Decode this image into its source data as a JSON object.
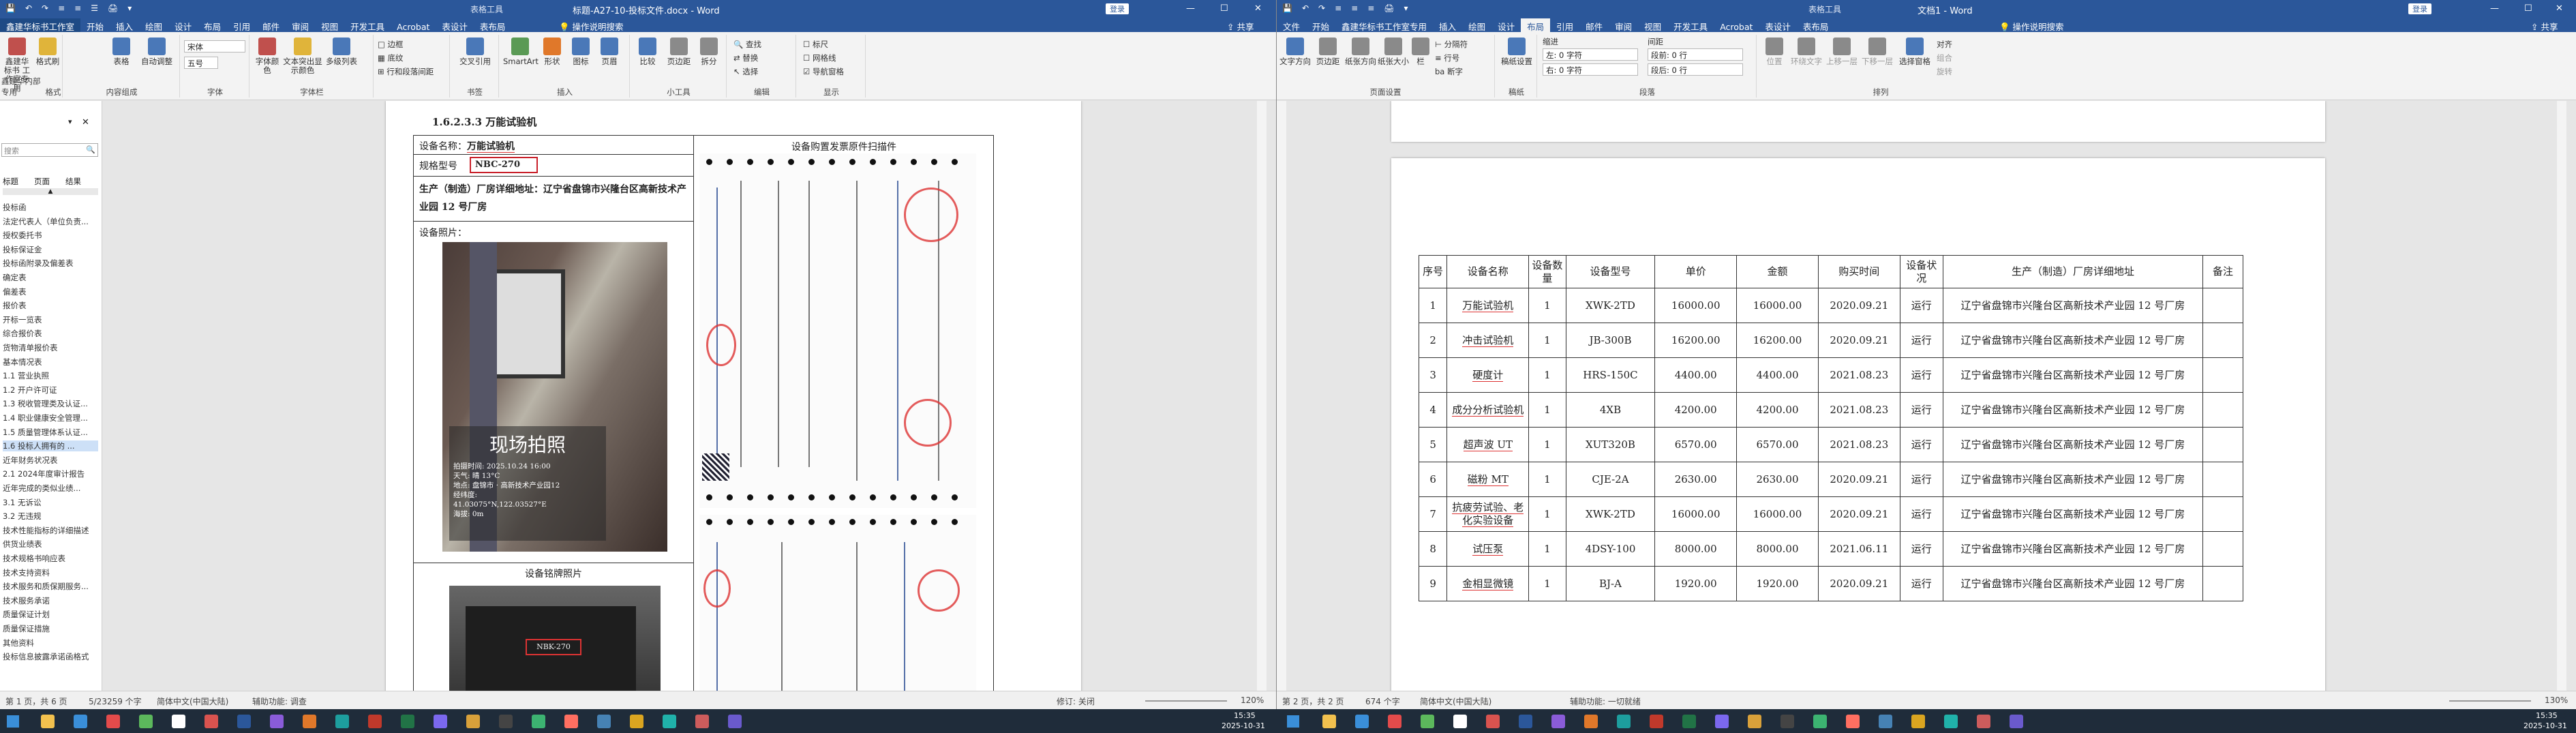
{
  "left_window": {
    "qa": [
      "💾",
      "↶",
      "↷",
      "≡",
      "≡",
      "☰",
      "🖨",
      "▾"
    ],
    "context_label": "表格工具",
    "title": "标题-A27-10-投标文件.docx  -  Word",
    "share": "共享",
    "login": "登录",
    "tabs": [
      "鑫建华标书工作室",
      "开始",
      "插入",
      "绘图",
      "设计",
      "布局",
      "引用",
      "邮件",
      "审阅",
      "视图",
      "开发工具",
      "Acrobat",
      "表设计",
      "表布局"
    ],
    "tell_me": "操作说明搜索",
    "ribbon": {
      "g1_btn": "鑫建华标书 工作室专用",
      "g1_btn2": "格式刷",
      "g1_label": "鑫建华内部专用",
      "g1b_label": "格式",
      "g2": [
        "表格",
        "自动调整"
      ],
      "g2_label": "内容组成",
      "font_name": "宋体",
      "font_size": "五号",
      "font_label": "字体",
      "g4": [
        "字体颜色",
        "文本突出显示颜色",
        "多级列表"
      ],
      "g4_label": "字体栏",
      "g5": [
        "□ 边框",
        "▦ 底纹",
        "⊞ 行和段落间距"
      ],
      "g6": [
        "交叉引用"
      ],
      "g6_label": "书签",
      "g7": [
        "SmartArt",
        "形状",
        "图标",
        "页眉"
      ],
      "g7_label": "插入",
      "g8": [
        "比较",
        "页边距",
        "拆分"
      ],
      "g8_label": "小工具",
      "g9": [
        "查找",
        "替换",
        "选择"
      ],
      "g9_label": "编辑",
      "g10": [
        "☐ 标尺",
        "☐ 网格线",
        "☑ 导航窗格"
      ],
      "g10_label": "显示"
    },
    "nav": {
      "search_placeholder": "搜索",
      "tabs": [
        "标题",
        "页面",
        "结果"
      ],
      "items": [
        "投标函",
        "法定代表人（单位负责...",
        "授权委托书",
        "投标保证金",
        "投标函附录及偏差表",
        "确定表",
        "偏差表",
        "报价表",
        "开标一览表",
        "综合报价表",
        "货物清单报价表",
        "基本情况表",
        "1.1 营业执照",
        "1.2 开户许可证",
        "1.3 税收管理类及认证...",
        "1.4 职业健康安全管理...",
        "1.5 质量管理体系认证...",
        "1.6 投标人拥有的 ...",
        "近年财务状况表",
        "2.1 2024年度审计报告",
        "近年完成的类似业绩...",
        "3.1 无诉讼",
        "3.2 无违规",
        "技术性能指标的详细描述",
        "供货业绩表",
        "技术规格书响应表",
        "技术支持资料",
        "技术服务和质保期服务...",
        "技术服务承诺",
        "质量保证计划",
        "质量保证措施",
        "其他资料",
        "投标信息披露承诺函格式"
      ],
      "selected": 17
    },
    "heading": "1.6.2.3.3  万能试验机",
    "form": {
      "name_label": "设备名称：",
      "name_val": "万能试验机",
      "model_label": "规格型号",
      "model_val": "NBC-270",
      "addr_label": "生产（制造）厂房详细地址：辽宁省盘锦市兴隆台区高新技术产业园 12 号厂房",
      "photo_label": "设备照片：",
      "nameplate_label": "设备铭牌照片",
      "invoice_label": "设备购置发票原件扫描件",
      "photo_overlay": "现场拍照",
      "photo_meta": [
        "拍摄时间: 2025.10.24 16:00",
        "天气: 晴 13°C",
        "地点: 盘锦市 · 高新技术产业园12",
        "经纬度:",
        "41.03075°N,122.03527°E",
        "海拔: 0m"
      ],
      "nameplate_model": "NBK-270"
    },
    "status": [
      "第 1 页，共 6 页",
      "5/23259 个字",
      "简体中文(中国大陆)",
      "辅助功能: 调查",
      "修订: 关闭"
    ],
    "zoom": "120%"
  },
  "right_window": {
    "qa": [
      "💾",
      "↶",
      "↷",
      "≡",
      "≡",
      "≡",
      "🖨",
      "▾"
    ],
    "context_label": "表格工具",
    "title": "文档1  -  Word",
    "login": "登录",
    "share": "共享",
    "tabs": [
      "文件",
      "开始",
      "鑫建华标书工作室专用",
      "插入",
      "绘图",
      "设计",
      "布局",
      "引用",
      "邮件",
      "审阅",
      "视图",
      "开发工具",
      "Acrobat",
      "表设计",
      "表布局"
    ],
    "tell_me": "操作说明搜索",
    "ribbon": {
      "g1": [
        "文字方向",
        "页边距",
        "纸张方向",
        "纸张大小",
        "栏"
      ],
      "g1_label": "页面设置",
      "g1_small": [
        "⊢ 分隔符",
        "≡ 行号",
        "ba 断字"
      ],
      "g2": [
        "稿纸设置"
      ],
      "g2_label": "稿纸",
      "indent_title": "缩进",
      "spacing_title": "间距",
      "indent": [
        "左: 0 字符",
        "右: 0 字符"
      ],
      "spacing": [
        "段前: 0 行",
        "段后: 0 行"
      ],
      "para_label": "段落",
      "g4": [
        "位置",
        "环绕文字",
        "上移一层",
        "下移一层",
        "选择窗格"
      ],
      "g4_small": [
        "对齐",
        "组合",
        "旋转"
      ],
      "g4_label": "排列"
    },
    "status": [
      "第 2 页，共 2 页",
      "674 个字",
      "简体中文(中国大陆)",
      "辅助功能: 一切就绪"
    ],
    "zoom": "130%",
    "table": {
      "headers": [
        "序号",
        "设备名称",
        "设备数量",
        "设备型号",
        "单价",
        "金额",
        "购买时间",
        "设备状况",
        "生产（制造）厂房详细地址",
        "备注"
      ],
      "rows": [
        [
          "1",
          "万能试验机",
          "1",
          "XWK-2TD",
          "16000.00",
          "16000.00",
          "2020.09.21",
          "运行",
          "辽宁省盘锦市兴隆台区高新技术产业园 12 号厂房",
          ""
        ],
        [
          "2",
          "冲击试验机",
          "1",
          "JB-300B",
          "16200.00",
          "16200.00",
          "2020.09.21",
          "运行",
          "辽宁省盘锦市兴隆台区高新技术产业园 12 号厂房",
          ""
        ],
        [
          "3",
          "硬度计",
          "1",
          "HRS-150C",
          "4400.00",
          "4400.00",
          "2021.08.23",
          "运行",
          "辽宁省盘锦市兴隆台区高新技术产业园 12 号厂房",
          ""
        ],
        [
          "4",
          "成分分析试验机",
          "1",
          "4XB",
          "4200.00",
          "4200.00",
          "2021.08.23",
          "运行",
          "辽宁省盘锦市兴隆台区高新技术产业园 12 号厂房",
          ""
        ],
        [
          "5",
          "超声波 UT",
          "1",
          "XUT320B",
          "6570.00",
          "6570.00",
          "2021.08.23",
          "运行",
          "辽宁省盘锦市兴隆台区高新技术产业园 12 号厂房",
          ""
        ],
        [
          "6",
          "磁粉 MT",
          "1",
          "CJE-2A",
          "2630.00",
          "2630.00",
          "2020.09.21",
          "运行",
          "辽宁省盘锦市兴隆台区高新技术产业园 12 号厂房",
          ""
        ],
        [
          "7",
          "抗疲劳试验、老化实验设备",
          "1",
          "XWK-2TD",
          "16000.00",
          "16000.00",
          "2020.09.21",
          "运行",
          "辽宁省盘锦市兴隆台区高新技术产业园 12 号厂房",
          ""
        ],
        [
          "8",
          "试压泵",
          "1",
          "4DSY-100",
          "8000.00",
          "8000.00",
          "2021.06.11",
          "运行",
          "辽宁省盘锦市兴隆台区高新技术产业园 12 号厂房",
          ""
        ],
        [
          "9",
          "金相显微镜",
          "1",
          "BJ-A",
          "1920.00",
          "1920.00",
          "2020.09.21",
          "运行",
          "辽宁省盘锦市兴隆台区高新技术产业园 12 号厂房",
          ""
        ]
      ]
    }
  },
  "taskbar": {
    "left_time": "15:35",
    "left_date": "2025-10-31",
    "right_time": "15:35",
    "right_date": "2025-10-31"
  },
  "colors": {
    "word_blue": "#2b579a",
    "ribbon_bg": "#f3f3f3",
    "redline": "#dd3333",
    "stamp": "#dd3333"
  }
}
